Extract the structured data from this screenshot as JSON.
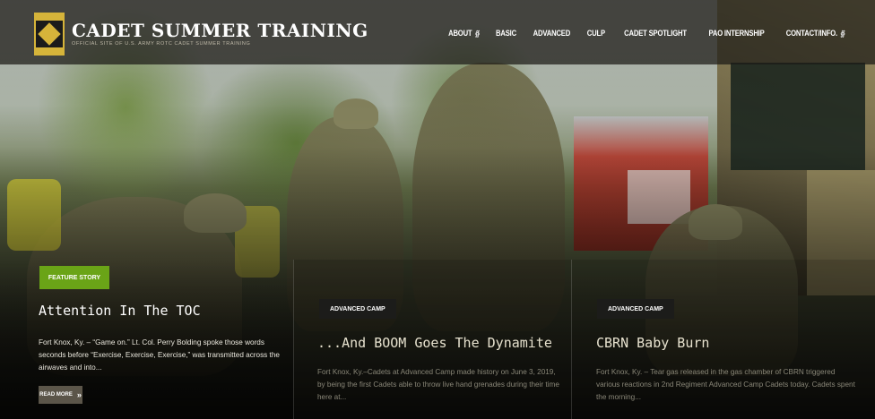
{
  "site": {
    "title": "CADET SUMMER TRAINING",
    "tagline": "OFFICIAL SITE OF U.S. ARMY ROTC CADET SUMMER TRAINING"
  },
  "nav": {
    "items": [
      {
        "label": "ABOUT",
        "has_dropdown": true
      },
      {
        "label": "BASIC",
        "has_dropdown": false
      },
      {
        "label": "ADVANCED",
        "has_dropdown": false
      },
      {
        "label": "CULP",
        "has_dropdown": false
      },
      {
        "label": "CADET SPOTLIGHT",
        "has_dropdown": false
      },
      {
        "label": "PAO INTERNSHIP",
        "has_dropdown": false
      },
      {
        "label": "CONTACT/INFO.",
        "has_dropdown": true
      }
    ],
    "dropdown_icon": "chevron-down-icon"
  },
  "cards": [
    {
      "tag": "FEATURE STORY",
      "title": "Attention In The TOC",
      "excerpt": "Fort Knox, Ky. – “Game on.” Lt. Col. Perry Bolding spoke those words seconds before “Exercise, Exercise, Exercise,” was transmitted across the airwaves and into...",
      "read_more": "READ MORE",
      "read_more_icon": "double-chevron-right-icon"
    },
    {
      "tag": "ADVANCED CAMP",
      "title": "...And BOOM Goes The Dynamite",
      "excerpt": "Fort Knox, Ky.–Cadets at Advanced Camp made history on June 3, 2019, by being the first Cadets able to throw live hand grenades during their time here at..."
    },
    {
      "tag": "ADVANCED CAMP",
      "title": "CBRN Baby Burn",
      "excerpt": "Fort Knox, Ky. – Tear gas released in the gas chamber of CBRN triggered various reactions in 2nd Regiment Advanced Camp Cadets today. Cadets spent the morning..."
    }
  ],
  "colors": {
    "feature_tag": "#6aa417",
    "logo_gold": "#d6b43a",
    "header_bg": "#1c1a16"
  }
}
